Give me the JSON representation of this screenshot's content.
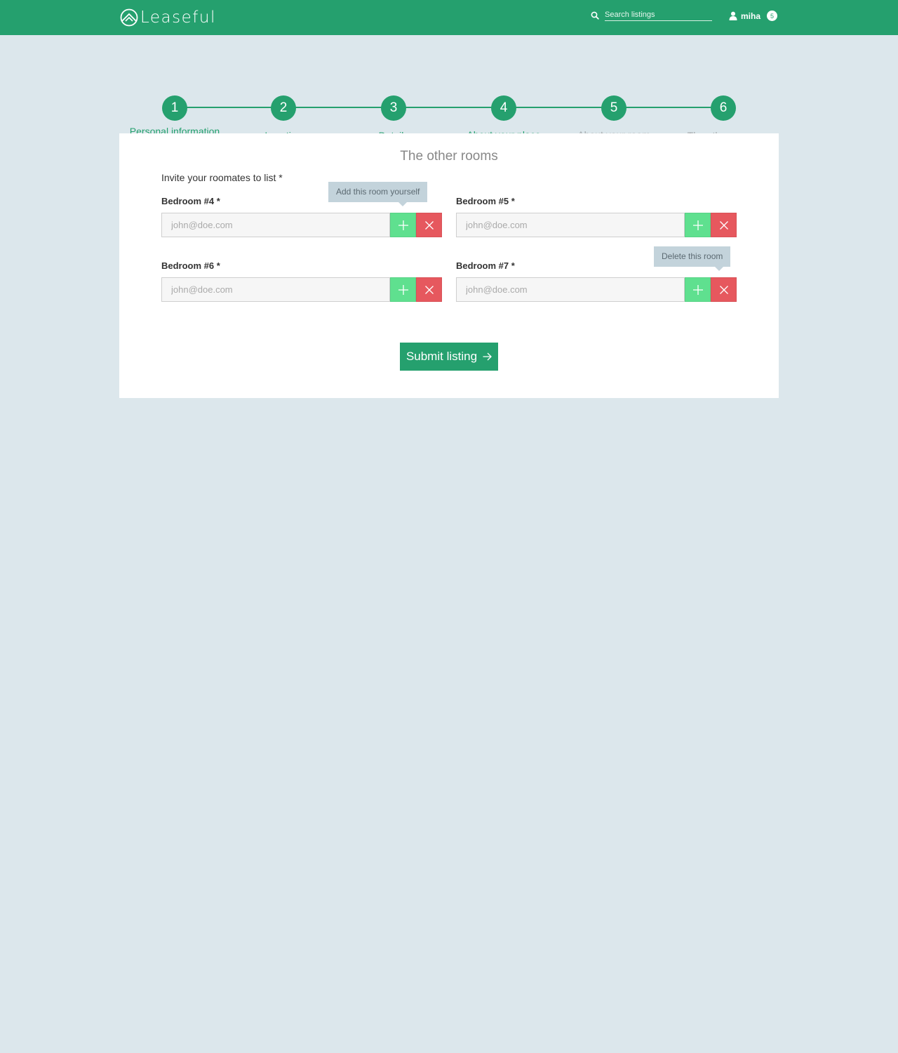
{
  "header": {
    "brand": "Leaseful",
    "search_placeholder": "Search listings",
    "user_name": "miha",
    "notification_count": "5",
    "brand_color": "#25a06e"
  },
  "stepper": {
    "steps": [
      {
        "number": "1",
        "label": "Personal information",
        "state": "done"
      },
      {
        "number": "2",
        "label": "Location",
        "state": "done"
      },
      {
        "number": "3",
        "label": "Details",
        "state": "done"
      },
      {
        "number": "4",
        "label": "About your place",
        "state": "done"
      },
      {
        "number": "5",
        "label": "About your room",
        "state": "muted"
      },
      {
        "number": "6",
        "label": "The other rooms",
        "state": "current"
      }
    ]
  },
  "form": {
    "title": "The other rooms",
    "invite_label": "Invite your roomates to list *",
    "rooms": [
      {
        "label": "Bedroom #4 *",
        "placeholder": "john@doe.com",
        "value": ""
      },
      {
        "label": "Bedroom #5 *",
        "placeholder": "john@doe.com",
        "value": ""
      },
      {
        "label": "Bedroom #6 *",
        "placeholder": "john@doe.com",
        "value": ""
      },
      {
        "label": "Bedroom #7 *",
        "placeholder": "john@doe.com",
        "value": ""
      }
    ],
    "tooltip_add": "Add this room yourself",
    "tooltip_delete": "Delete this room",
    "submit_label": "Submit listing",
    "add_color": "#5fe08f",
    "delete_color": "#e6585e"
  }
}
